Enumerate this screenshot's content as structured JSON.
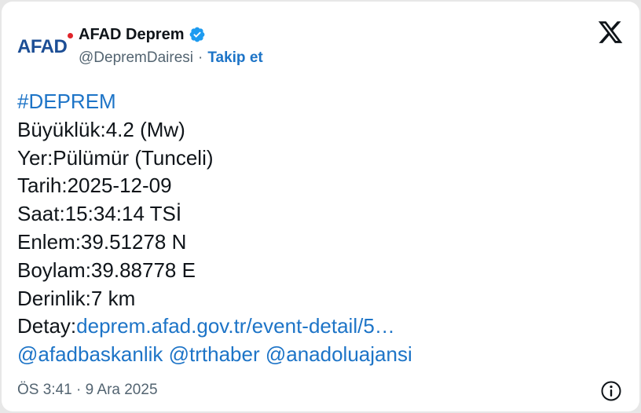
{
  "author": {
    "logo_text": "AFAD",
    "name": "AFAD Deprem",
    "handle": "@DepremDairesi",
    "separator": "·",
    "follow_label": "Takip et"
  },
  "icons": {
    "verified": "verified-badge-icon",
    "close": "x-logo-icon",
    "info": "info-icon"
  },
  "tweet": {
    "hashtag": "#DEPREM",
    "magnitude": "Büyüklük:4.2 (Mw)",
    "location": "Yer:Pülümür (Tunceli)",
    "date": "Tarih:2025-12-09",
    "time": "Saat:15:34:14 TSİ",
    "latitude": "Enlem:39.51278 N",
    "longitude": "Boylam:39.88778 E",
    "depth": "Derinlik:7 km",
    "detail_label": "Detay:",
    "detail_link": "deprem.afad.gov.tr/event-detail/5…",
    "mentions": [
      "@afadbaskanlik",
      "@trthaber",
      "@anadoluajansi"
    ]
  },
  "footer": {
    "timestamp": "ÖS 3:41 · 9 Ara 2025"
  },
  "colors": {
    "link": "#1d74c7",
    "text": "#0f1419",
    "muted": "#536471",
    "verified": "#1d9bf0",
    "logo_blue": "#1c4e95",
    "logo_red": "#e0242a"
  }
}
